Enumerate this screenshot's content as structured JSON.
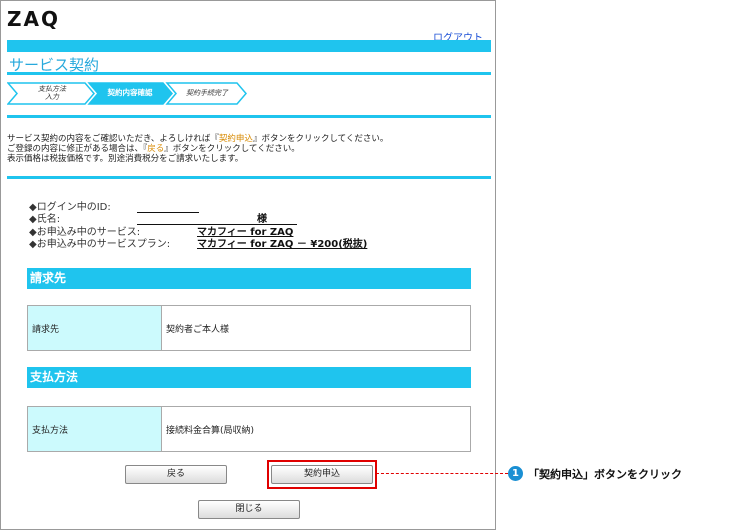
{
  "header": {
    "logo": "ZAQ",
    "logout": "ログアウト",
    "title": "サービス契約"
  },
  "steps": [
    {
      "label_line1": "支払方法",
      "label_line2": "入力",
      "current": false
    },
    {
      "label_line1": "契約内容確認",
      "label_line2": "",
      "current": true
    },
    {
      "label_line1": "契約手続完了",
      "label_line2": "",
      "current": false
    }
  ],
  "instructions": {
    "line1_pre": "サービス契約の内容をご確認いただき、よろしければ『",
    "line1_hl": "契約申込",
    "line1_post": "』ボタンをクリックしてください。",
    "line2_pre": "ご登録の内容に修正がある場合は、『",
    "line2_hl": "戻る",
    "line2_post": "』ボタンをクリックしてください。",
    "line3": "表示価格は税抜価格です。別途消費税分をご請求いたします。"
  },
  "account": {
    "login_id_label": "◆ログイン中のID:",
    "name_label": "◆氏名:",
    "name_suffix": "様",
    "service_label": "◆お申込み中のサービス:",
    "service_value": "マカフィー for ZAQ",
    "plan_label": "◆お申込み中のサービスプラン:",
    "plan_value": "マカフィー for ZAQ － ¥200(税抜)"
  },
  "billing": {
    "section_title": "請求先",
    "row_label": "請求先",
    "row_value": "契約者ご本人様"
  },
  "payment": {
    "section_title": "支払方法",
    "row_label": "支払方法",
    "row_value": "接続料金合算(局収納)"
  },
  "buttons": {
    "back": "戻る",
    "apply": "契約申込",
    "close": "閉じる"
  },
  "callout": {
    "number": "1",
    "text": "「契約申込」ボタンをクリック"
  },
  "colors": {
    "accent_cyan": "#1fc4ee",
    "table_header_bg": "#ccfafd",
    "highlight_red": "#e00000",
    "callout_blue": "#1a8fd3"
  }
}
